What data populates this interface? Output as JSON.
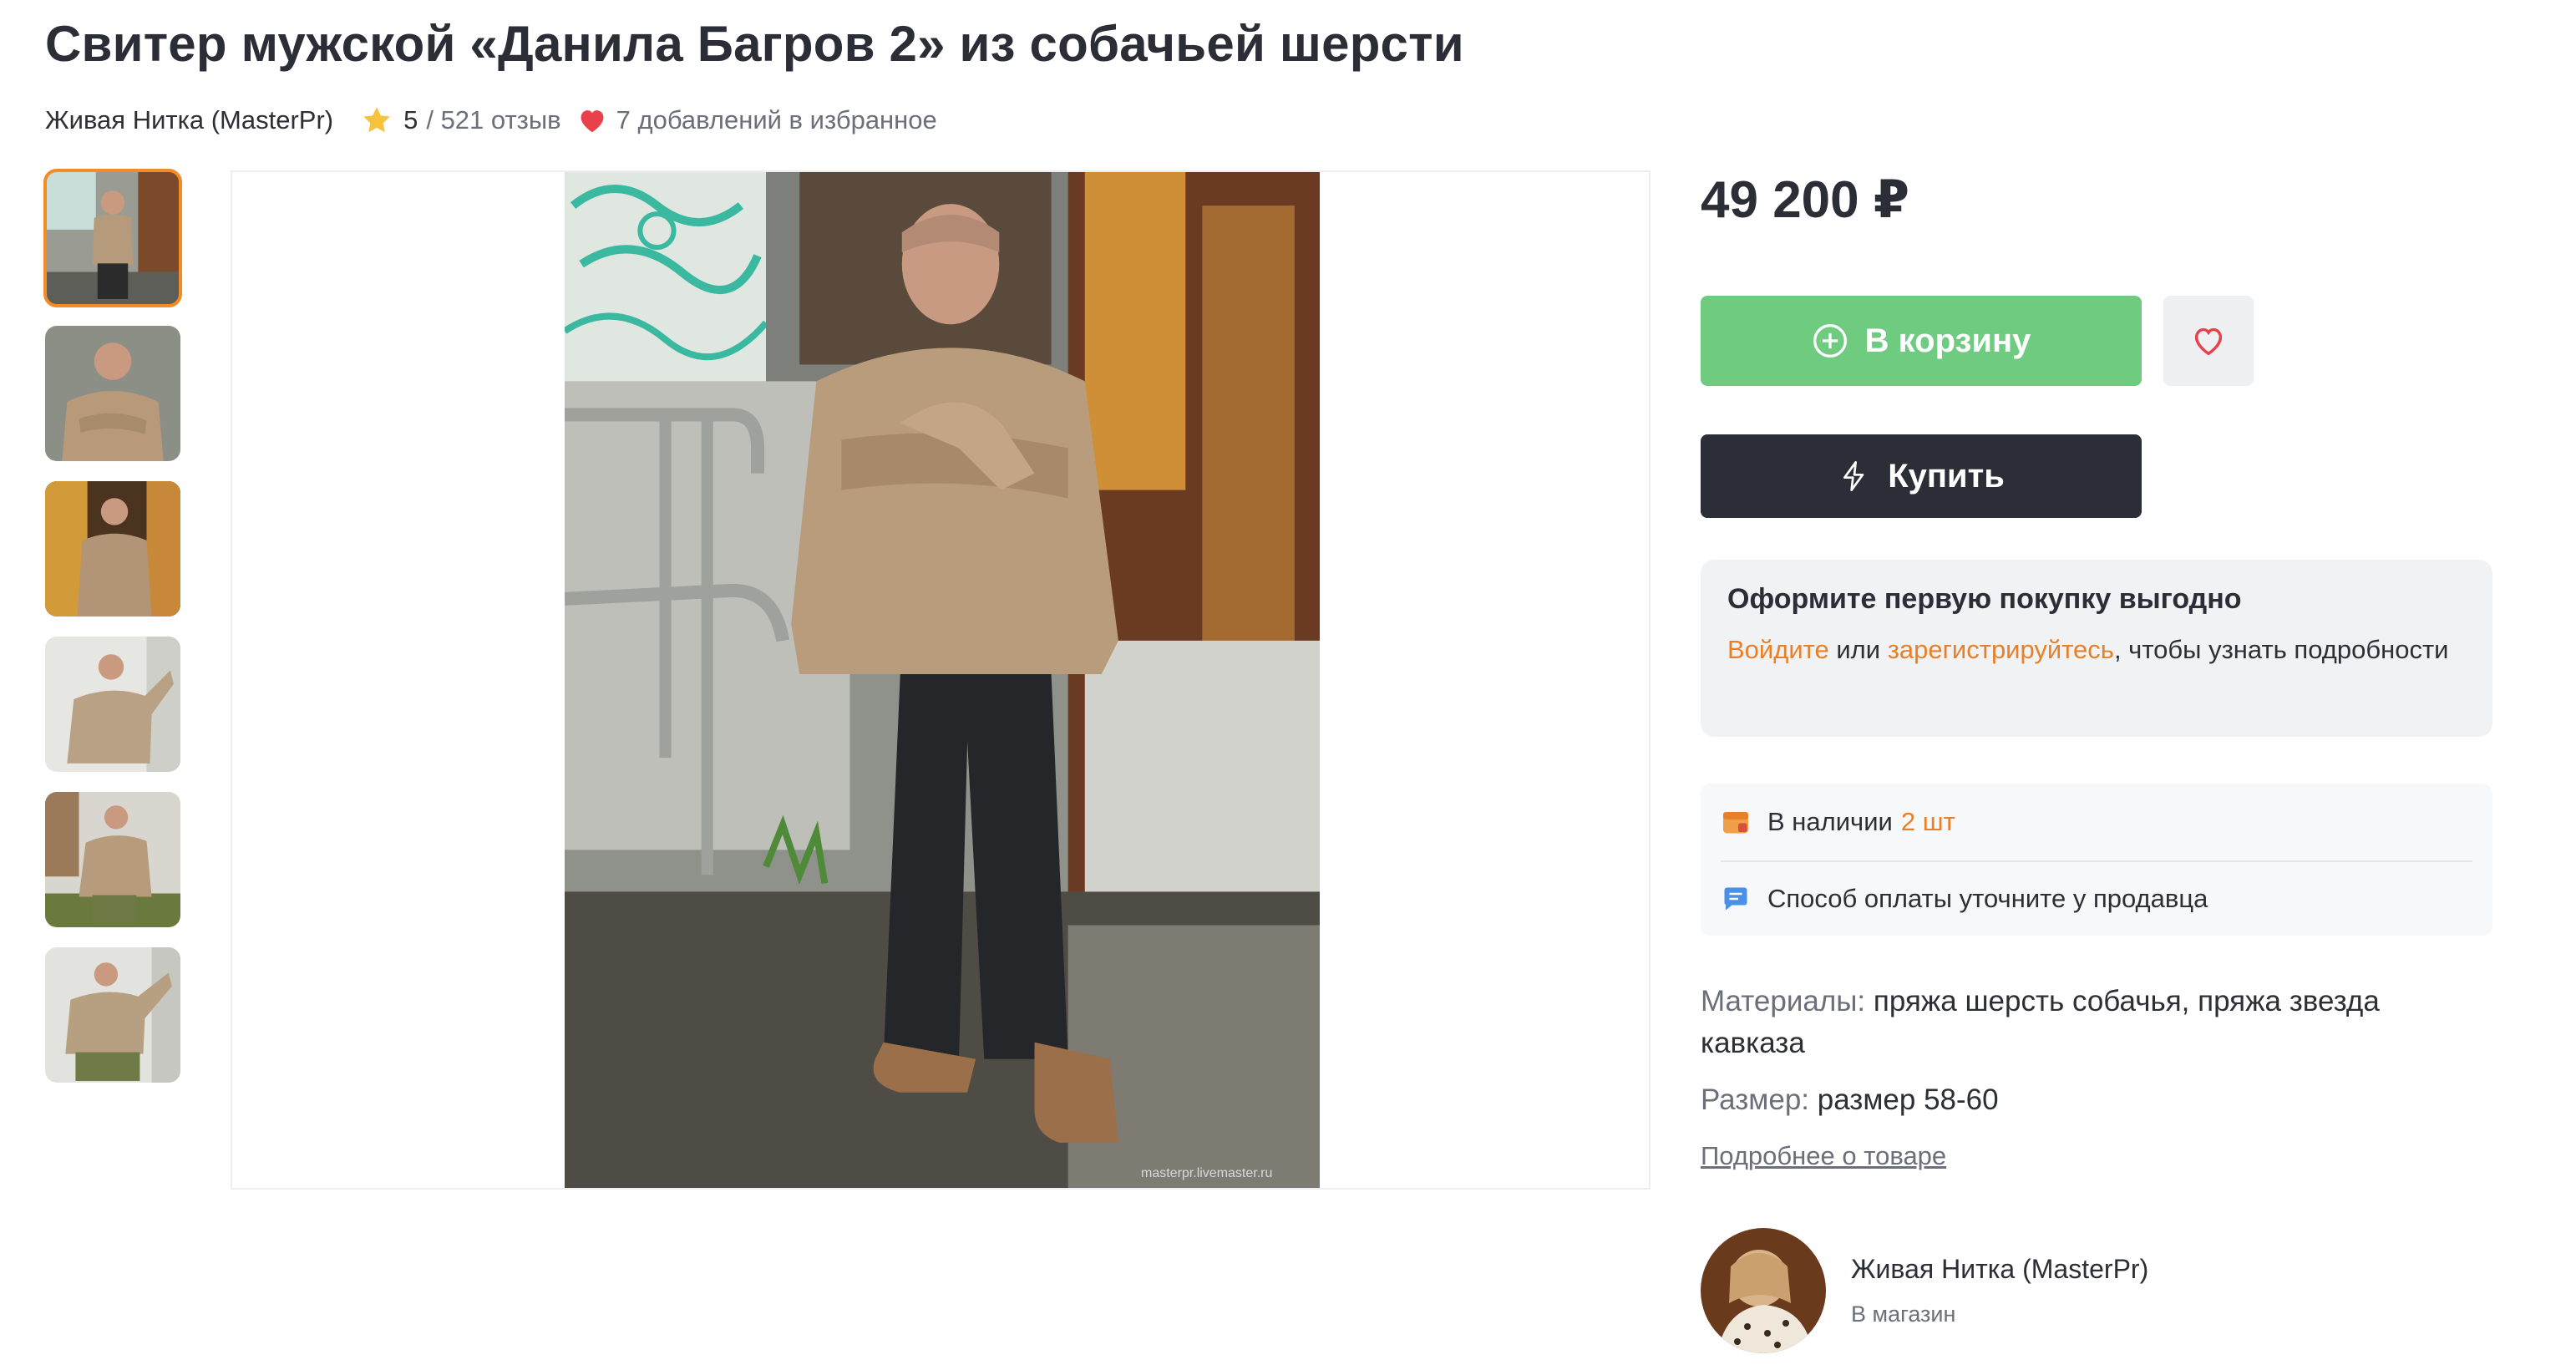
{
  "product": {
    "title": "Свитер мужской «Данила Багров 2» из собачьей шерсти",
    "seller_name": "Живая Нитка (MasterPr)",
    "rating": "5",
    "reviews": "/ 521 отзыв",
    "favorites": "7 добавлений в избранное",
    "price": "49 200 ₽"
  },
  "icons": {
    "rating": "star-icon",
    "favorites": "heart-icon",
    "cart": "plus-circle-icon",
    "buy": "lightning-icon",
    "wishlist": "heart-outline-icon",
    "stock": "box-icon",
    "payment": "chat-icon"
  },
  "colors": {
    "accent_orange": "#f28c28",
    "cart_green": "#6ecb80",
    "buy_dark": "#2b2e37",
    "link_orange": "#e8802a",
    "heart_red": "#e8414b",
    "star_yellow": "#f7c23c"
  },
  "gallery": {
    "thumbnail_count": 6,
    "active_index": 0,
    "watermark": "masterpr.livemaster.ru"
  },
  "actions": {
    "cart_label": "В корзину",
    "buy_label": "Купить"
  },
  "promo": {
    "title": "Оформите первую покупку выгодно",
    "login": "Войдите",
    "or": " или ",
    "register": "зарегистрируйтесь",
    "rest": ", чтобы узнать подробности"
  },
  "stock": {
    "availability": "В наличии",
    "count": "2 шт",
    "payment": "Способ оплаты уточните у продавца"
  },
  "specs": {
    "materials_label": "Материалы:",
    "materials_value": "пряжа шерсть собачья, пряжа звезда кавказа",
    "size_label": "Размер:",
    "size_value": "размер 58-60",
    "more_link": "Подробнее о товаре"
  },
  "seller": {
    "name": "Живая Нитка (MasterPr)",
    "shop_link": "В магазин"
  }
}
